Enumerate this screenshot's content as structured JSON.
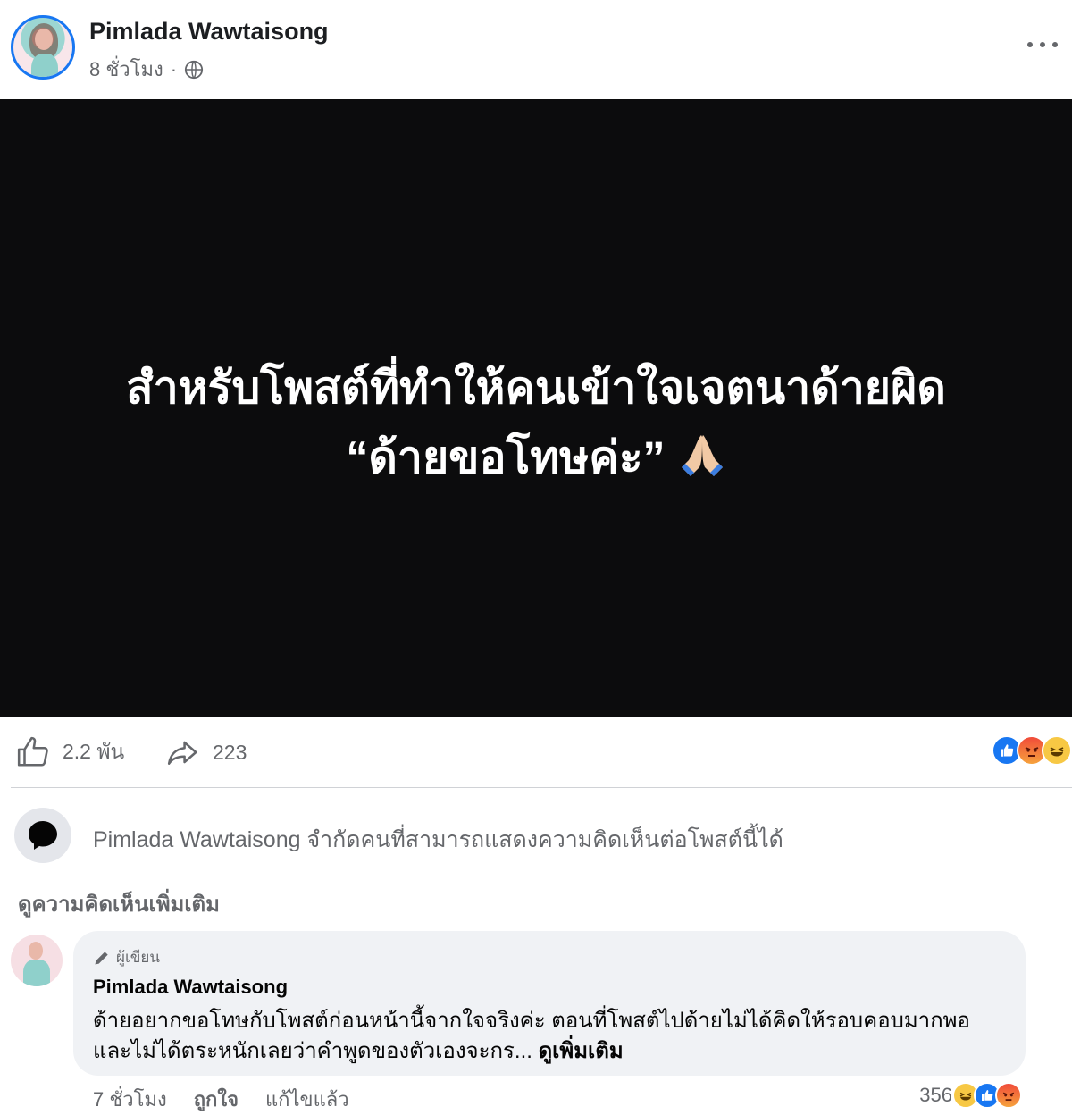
{
  "post": {
    "author": "Pimlada Wawtaisong",
    "time": "8 ชั่วโมง",
    "separator": "·",
    "visibility_icon": "globe-icon",
    "image_text_line1": "สำหรับโพสต์ที่ทำให้คนเข้าใจเจตนาด้ายผิด",
    "image_text_line2": "“ด้ายขอโทษค่ะ”",
    "image_emoji": "folded-hands-icon"
  },
  "stats": {
    "likes": "2.2 พัน",
    "shares": "223",
    "reactions": [
      "like",
      "angry",
      "haha"
    ]
  },
  "notice": {
    "text": "Pimlada Wawtaisong จำกัดคนที่สามารถแสดงความคิดเห็นต่อโพสต์นี้ได้"
  },
  "comments": {
    "view_more": "ดูความคิดเห็นเพิ่มเติม",
    "items": [
      {
        "badge": "ผู้เขียน",
        "author": "Pimlada Wawtaisong",
        "text": "ด้ายอยากขอโทษกับโพสต์ก่อนหน้านี้จากใจจริงค่ะ ตอนที่โพสต์ไปด้ายไม่ได้คิดให้รอบคอบมากพอ และไม่ได้ตระหนักเลยว่าคำพูดของตัวเองจะกร...",
        "see_more": "ดูเพิ่มเติม",
        "time": "7 ชั่วโมง",
        "like_action": "ถูกใจ",
        "edited": "แก้ไขแล้ว",
        "reaction_count": "356",
        "reactions": [
          "haha",
          "like",
          "angry"
        ]
      }
    ]
  },
  "colors": {
    "accent": "#1877f2",
    "secondary_text": "#65676b",
    "image_bg": "#0c0c0d",
    "bubble_bg": "#f0f2f5"
  }
}
